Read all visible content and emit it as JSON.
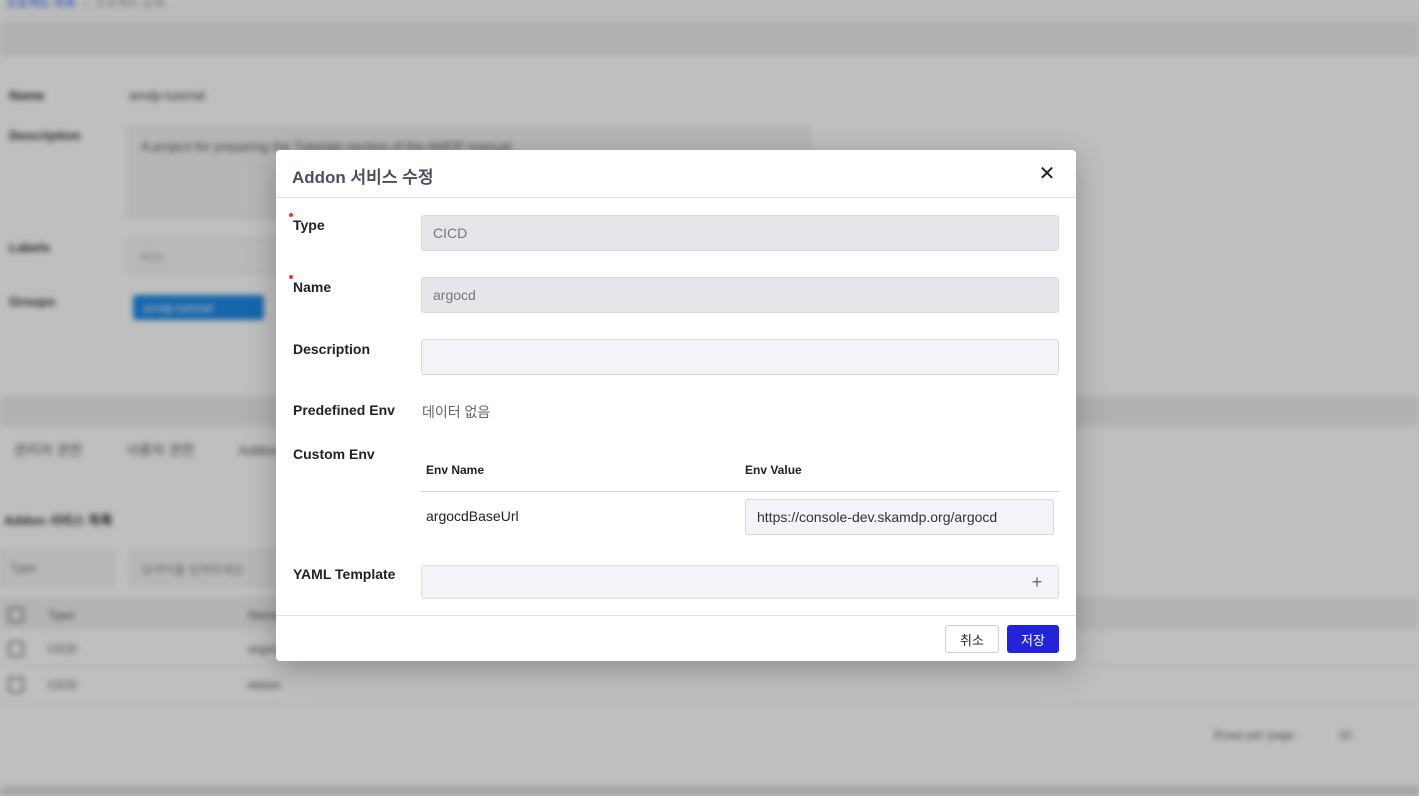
{
  "background": {
    "breadcrumb": {
      "parent": "프로젝트 목록",
      "current": "프로젝트 상세"
    },
    "info": {
      "name_label": "Name",
      "name_value": "amdp-tutorial",
      "description_label": "Description",
      "description_value": "A project for preparing the Tutorials section of the AMDP manual.",
      "labels_label": "Labels",
      "labels_placeholder": "Key",
      "groups_label": "Groups",
      "group_chip": "amdp-tutorial"
    },
    "tabs": [
      "관리자 권한",
      "사용자 권한",
      "Addon"
    ],
    "addon_list_title": "Addon 서비스 목록",
    "type_filter": "Type",
    "search_placeholder": "검색어를 입력하세요",
    "table_headers": [
      "Type",
      "Name"
    ],
    "rows": [
      {
        "type": "CICD",
        "name": "argocd"
      },
      {
        "type": "CICD",
        "name": "tekton"
      }
    ],
    "rows_per_page_label": "Rows per page",
    "rows_per_page_value": "10"
  },
  "modal": {
    "title": "Addon 서비스 수정",
    "type_label": "Type",
    "type_value": "CICD",
    "name_label": "Name",
    "name_value": "argocd",
    "description_label": "Description",
    "description_value": "",
    "predefined_env_label": "Predefined Env",
    "predefined_env_empty": "데이터 없음",
    "custom_env_label": "Custom Env",
    "custom_env": {
      "col_name": "Env Name",
      "col_value": "Env Value",
      "rows": [
        {
          "name": "argocdBaseUrl",
          "value": "https://console-dev.skamdp.org/argocd"
        }
      ]
    },
    "yaml_label": "YAML Template",
    "yaml_add_icon": "+",
    "cancel_label": "취소",
    "save_label": "저장",
    "close_icon": "✕",
    "accent_color": "#2323d8",
    "required_color": "#e53935"
  }
}
